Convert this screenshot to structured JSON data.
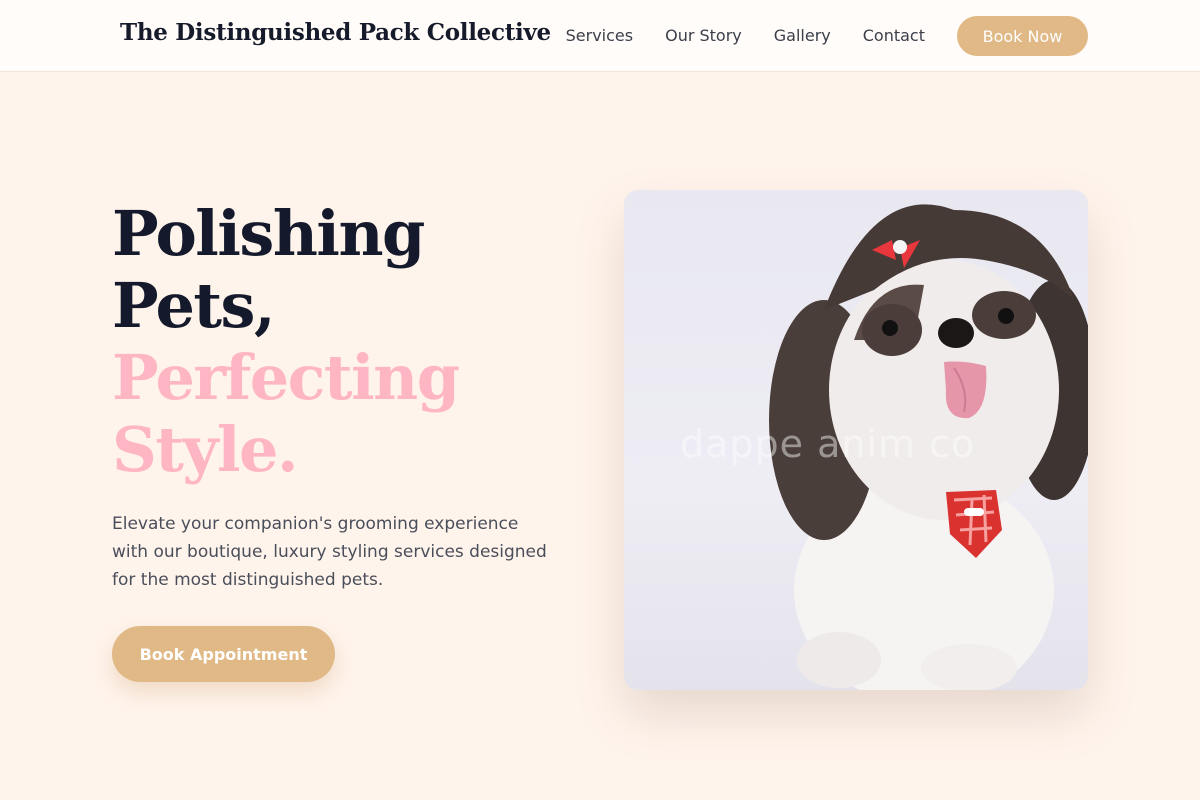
{
  "header": {
    "brand": "The Distinguished Pack Collective",
    "nav": [
      "Services",
      "Our Story",
      "Gallery",
      "Contact"
    ],
    "book_label": "Book Now"
  },
  "hero": {
    "title_lines": [
      "Polishing",
      "Pets,",
      "Perfecting",
      "Style."
    ],
    "subtitle": "Elevate your companion's grooming experience with our boutique, luxury styling services designed for the most distinguished pets.",
    "cta_label": "Book Appointment",
    "image": {
      "watermark": "dappe  anim   co"
    }
  },
  "colors": {
    "accent": "#e0b987",
    "highlight_pink": "#ffb6c4",
    "background": "#fff4ec",
    "heading": "#141a2b"
  }
}
